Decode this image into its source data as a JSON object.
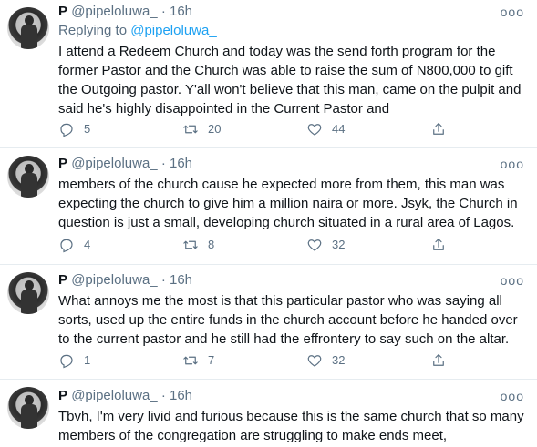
{
  "tweets": [
    {
      "name": "P",
      "handle": "@pipeloluwa_",
      "dot": "·",
      "time": "16h",
      "more": "ooo",
      "reply_prefix": "Replying to",
      "reply_mention": "@pipeloluwa_",
      "text": "I attend a Redeem Church and today was the send forth program for the former Pastor and the Church was able to raise the sum of N800,000 to gift the Outgoing pastor. Y'all won't believe that this man, came on the pulpit and said he's highly disappointed in the Current Pastor and",
      "replies": "5",
      "retweets": "20",
      "likes": "44"
    },
    {
      "name": "P",
      "handle": "@pipeloluwa_",
      "dot": "·",
      "time": "16h",
      "more": "ooo",
      "text": "members of the church cause he expected more from them, this man was expecting the church to give him a million naira or more. Jsyk, the Church in question is just a small, developing church situated in a rural area of Lagos.",
      "replies": "4",
      "retweets": "8",
      "likes": "32"
    },
    {
      "name": "P",
      "handle": "@pipeloluwa_",
      "dot": "·",
      "time": "16h",
      "more": "ooo",
      "text": "What annoys me the most is that this particular pastor who was saying all sorts, used up the entire funds in the church account before he handed over to the current pastor and he still had the effrontery to say such on the altar.",
      "replies": "1",
      "retweets": "7",
      "likes": "32"
    },
    {
      "name": "P",
      "handle": "@pipeloluwa_",
      "dot": "·",
      "time": "16h",
      "more": "ooo",
      "text": "Tbvh, I'm very livid and furious because this is the same church that so many members of the congregation are struggling to make ends meet,"
    }
  ],
  "colors": {
    "text": "#0f1419",
    "secondary": "#5b7083",
    "link": "#1da1f2",
    "separator": "#e6ecf0"
  },
  "icons": [
    "reply-icon",
    "retweet-icon",
    "like-icon",
    "share-icon",
    "more-icon"
  ]
}
